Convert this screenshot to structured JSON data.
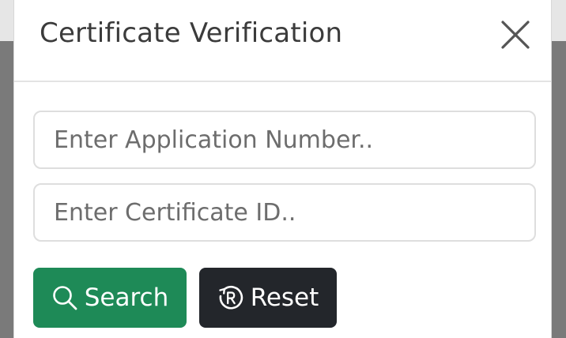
{
  "modal": {
    "title": "Certificate Verification",
    "close_icon": "close-icon"
  },
  "form": {
    "application_number": {
      "value": "",
      "placeholder": "Enter Application Number.."
    },
    "certificate_id": {
      "value": "",
      "placeholder": "Enter Certificate ID.."
    },
    "search_button": {
      "label": "Search",
      "icon": "search-icon"
    },
    "reset_button": {
      "label": "Reset",
      "icon": "reset-icon"
    }
  },
  "colors": {
    "search_button": "#1e8a57",
    "reset_button": "#23262b",
    "title_text": "#3b3b3b"
  }
}
